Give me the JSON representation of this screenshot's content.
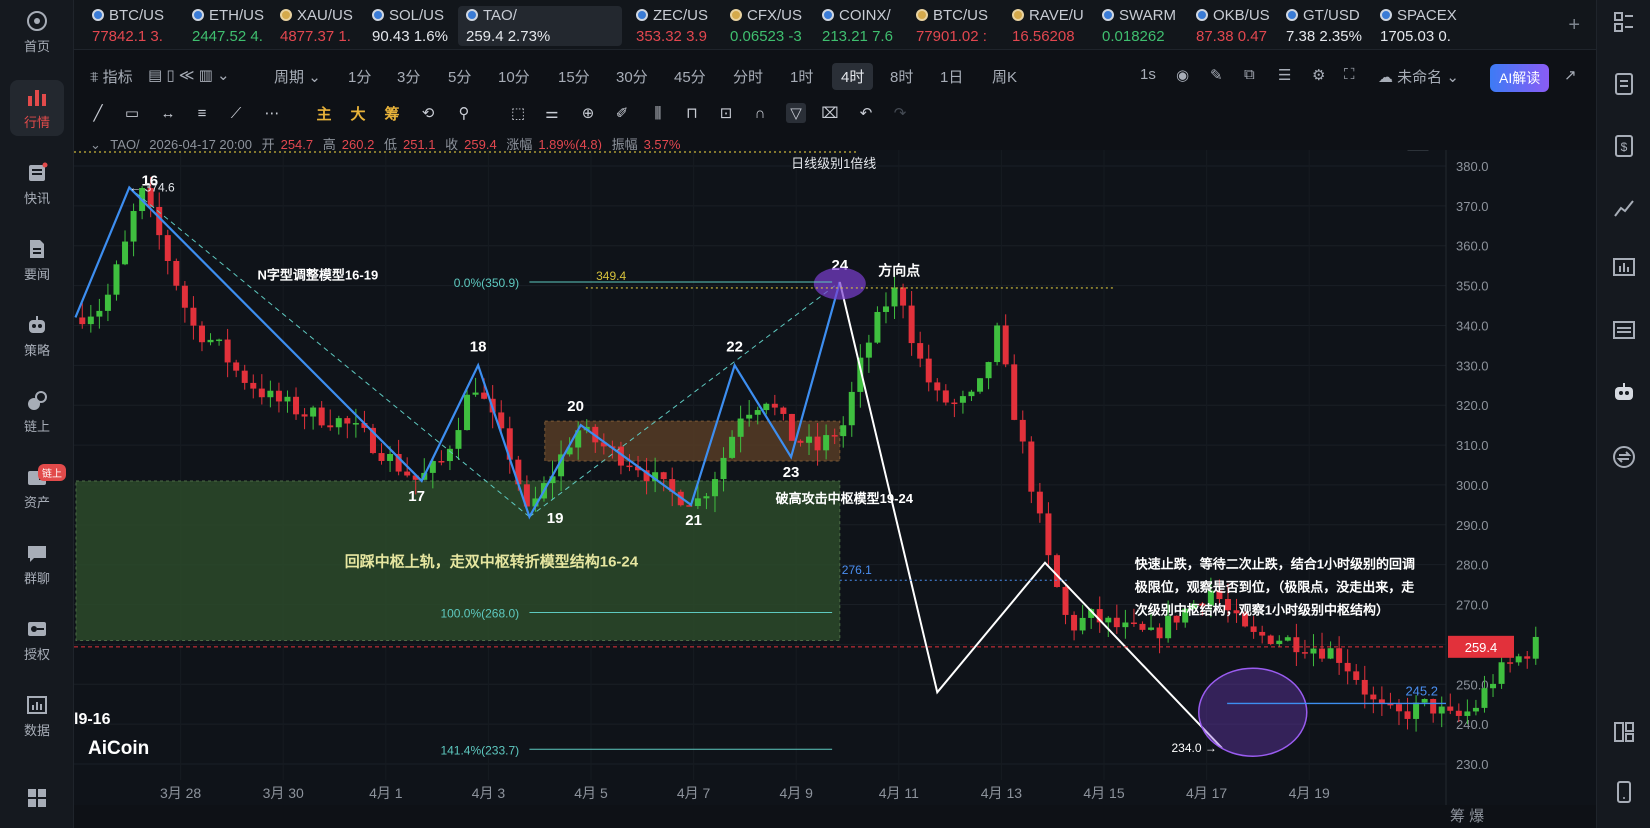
{
  "nav": {
    "items": [
      {
        "label": "首页",
        "icon": "home-icon"
      },
      {
        "label": "行情",
        "icon": "market-chart-icon"
      },
      {
        "label": "快讯",
        "icon": "news-flash-icon"
      },
      {
        "label": "要闻",
        "icon": "headline-icon"
      },
      {
        "label": "策略",
        "icon": "robot-strategy-icon"
      },
      {
        "label": "链上",
        "icon": "chain-icon"
      },
      {
        "label": "资产",
        "icon": "wallet-icon"
      },
      {
        "label": "群聊",
        "icon": "chat-icon"
      },
      {
        "label": "授权",
        "icon": "key-icon"
      },
      {
        "label": "数据",
        "icon": "data-icon"
      }
    ],
    "badge": "链上"
  },
  "tickers": [
    {
      "symbol": "BTC/US",
      "price": "77842.1",
      "change": "3.",
      "dir": "down"
    },
    {
      "symbol": "ETH/US",
      "price": "2447.52",
      "change": "4.",
      "dir": "up"
    },
    {
      "symbol": "XAU/US",
      "price": "4877.37",
      "change": "1.",
      "dir": "down"
    },
    {
      "symbol": "SOL/US",
      "price": "90.43",
      "change": "1.6%",
      "dir": "white"
    },
    {
      "symbol": "TAO/",
      "price": "259.4",
      "change": "2.73%",
      "dir": "white"
    },
    {
      "symbol": "ZEC/US",
      "price": "353.32",
      "change": "3.9",
      "dir": "down"
    },
    {
      "symbol": "CFX/US",
      "price": "0.06523",
      "change": "-3",
      "dir": "up"
    },
    {
      "symbol": "COINX/",
      "price": "213.21",
      "change": "7.6",
      "dir": "up"
    },
    {
      "symbol": "BTC/US",
      "price": "77901.02",
      "change": ":",
      "dir": "down"
    },
    {
      "symbol": "RAVE/U",
      "price": "16.56208",
      "change": "",
      "dir": "down"
    },
    {
      "symbol": "SWARM",
      "price": "0.018262",
      "change": "",
      "dir": "up"
    },
    {
      "symbol": "OKB/US",
      "price": "87.38",
      "change": "0.47",
      "dir": "down"
    },
    {
      "symbol": "GT/USD",
      "price": "7.38",
      "change": "2.35%",
      "dir": "white"
    },
    {
      "symbol": "SPACEX",
      "price": "1705.03",
      "change": "0.",
      "dir": "white"
    }
  ],
  "toolbar": {
    "indicator": "指标",
    "period": "周期",
    "intervals": [
      "1分",
      "3分",
      "5分",
      "10分",
      "15分",
      "30分",
      "45分",
      "分时",
      "1时",
      "4时",
      "8时",
      "1日",
      "周K"
    ],
    "active_interval": "4时",
    "speed": "1s",
    "layout_name": "未命名",
    "ai_button": "AI解读"
  },
  "drawtools": {
    "main": "主",
    "big": "大",
    "chip": "筹"
  },
  "info": {
    "symbol": "TAO/",
    "datetime": "2026-04-17 20:00",
    "open_label": "开",
    "open": "254.7",
    "high_label": "高",
    "high": "260.2",
    "low_label": "低",
    "low": "251.1",
    "close_label": "收",
    "close": "259.4",
    "change_label": "涨幅",
    "change": "1.89%(4.8)",
    "amplitude_label": "振幅",
    "amplitude": "3.57%"
  },
  "chart_data": {
    "type": "candlestick",
    "symbol": "TAO/",
    "interval": "4时",
    "ylim": [
      226,
      384
    ],
    "yticks": [
      380,
      370,
      360,
      350,
      340,
      330,
      320,
      310,
      300,
      290,
      280,
      270,
      260,
      250,
      240,
      230
    ],
    "ytick_labels": [
      "380.0",
      "370.0",
      "360.0",
      "350.0",
      "340.0",
      "330.0",
      "320.0",
      "310.0",
      "300.0",
      "290.0",
      "280.0",
      "270.0",
      "260.0",
      "250.0",
      "240.0",
      "230.0"
    ],
    "xticks": [
      "3月 28",
      "3月 30",
      "4月 1",
      "4月 3",
      "4月 5",
      "4月 7",
      "4月 9",
      "4月 11",
      "4月 13",
      "4月 15",
      "4月 17",
      "4月 19"
    ],
    "current_price": "259.4",
    "right_level": "245.2",
    "zigzag_blue": [
      {
        "label": "16",
        "price": 374.6
      },
      {
        "label": "17",
        "price": 301
      },
      {
        "label": "18",
        "price": 330
      },
      {
        "label": "19",
        "price": 292
      },
      {
        "label": "20",
        "price": 315
      },
      {
        "label": "21",
        "price": 295
      },
      {
        "label": "22",
        "price": 330
      },
      {
        "label": "23",
        "price": 307
      },
      {
        "label": "24",
        "price": 350.9
      }
    ],
    "zigzag_white": [
      350.9,
      248,
      280.5,
      234
    ],
    "point_labels": [
      "16",
      "17",
      "18",
      "19",
      "20",
      "21",
      "22",
      "23",
      "24"
    ],
    "price_labels": {
      "top_left": "← 374.6",
      "fib_349": "349.4",
      "mid_276": "276.1",
      "bottom": "234.0 →"
    },
    "fib_levels": [
      {
        "label": "0.0%(350.9)",
        "price": 350.9
      },
      {
        "label": "100.0%(268.0)",
        "price": 268.0
      },
      {
        "label": "141.4%(233.7)",
        "price": 233.7
      }
    ],
    "zones": [
      {
        "name": "green-center",
        "top": 301,
        "bottom": 261
      },
      {
        "name": "orange-center",
        "top": 316,
        "bottom": 306
      }
    ],
    "annotations": {
      "daily_level": "日线级别1倍线",
      "n_model": "N字型调整模型16-19",
      "direction_point": "方向点",
      "break_high": "破高攻击中枢模型19-24",
      "retest": "回踩中枢上轨，走双中枢转折模型结构16-24",
      "note": [
        "快速止跌，等待二次止跌，结合1小时级别的回调",
        "极限位，观察是否到位，（极限点，没走出来，走",
        "次级别中枢结构，观察1小时级别中枢结构）"
      ],
      "left_cut": "l9-16"
    },
    "watermark": "AiCoin",
    "colors": {
      "up": "#3fbf3f",
      "down": "#e2313b",
      "zigzag": "#3d8ef0",
      "white_line": "#ffffff",
      "green_zone": "#2c4a2a",
      "orange_zone": "#5a3e25",
      "ellipse": "#7b3fd0",
      "price_line": "#e2313b"
    }
  },
  "bottom_right": "筹 爆"
}
